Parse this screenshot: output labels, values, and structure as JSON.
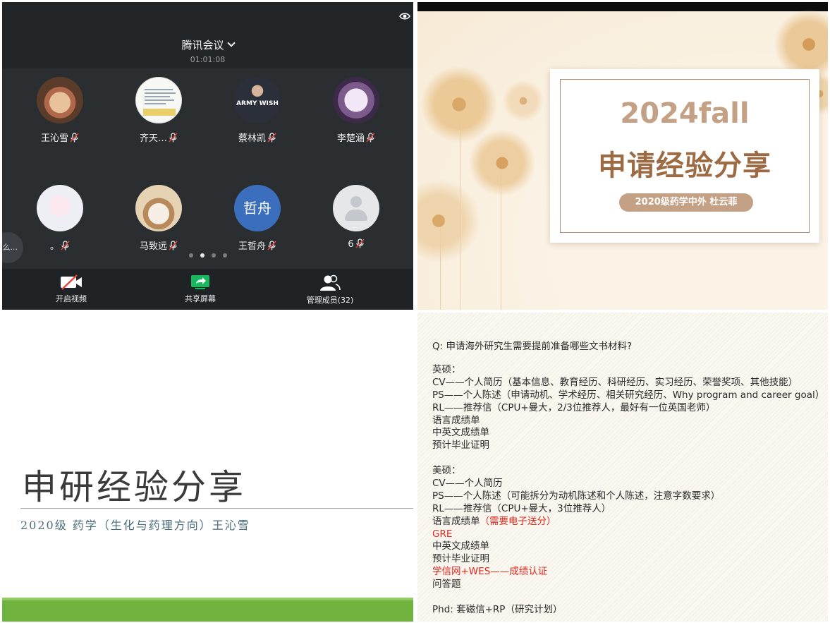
{
  "meeting": {
    "title": "腾讯会议",
    "timer": "01:01:08",
    "members": [
      {
        "name": "王沁雪",
        "avatar": "hamster-photo"
      },
      {
        "name": "齐天…",
        "avatar": "document-thumbnail"
      },
      {
        "name": "蔡林凯",
        "avatar": "army-hoodie-photo",
        "avatar_text": "ARMY WISH"
      },
      {
        "name": "李楚涵",
        "avatar": "anime-avatar"
      },
      {
        "name": "。",
        "avatar": "anime-girl-avatar"
      },
      {
        "name": "马致远",
        "avatar": "cat-avatar"
      },
      {
        "name": "王哲舟",
        "avatar": "text-avatar",
        "avatar_text": "哲舟"
      },
      {
        "name": "6",
        "avatar": "default-avatar"
      }
    ],
    "chat_bubble": "么...",
    "page_dots": {
      "count": 4,
      "active": 2
    },
    "toolbar": {
      "video_label": "开启视频",
      "share_label": "共享屏幕",
      "members_label": "管理成员(32)"
    },
    "colors": {
      "background": "#2b2e31",
      "share_green": "#18b85e",
      "video_off_red": "#e5413b"
    }
  },
  "slide_title": {
    "line1": "2024fall",
    "line2": "申请经验分享",
    "presenter": "2020级药学中外 杜云菲",
    "colors": {
      "accent": "#c4a185",
      "heading": "#9c6b44"
    }
  },
  "slide_intro": {
    "heading": "申研经验分享",
    "subtitle": "2020级 药学（生化与药理方向）王沁雪",
    "colors": {
      "band": "#6fb33e",
      "subtitle": "#4a6d7c"
    }
  },
  "slide_qa": {
    "question": "Q: 申请海外研究生需要提前准备哪些文书材料?",
    "uk_header": "英硕：",
    "uk_items": [
      "CV——个人简历（基本信息、教育经历、科研经历、实习经历、荣誉奖项、其他技能）",
      "PS——个人陈述（申请动机、学术经历、相关研究经历、Why program and career goal）",
      "RL——推荐信（CPU+曼大，2/3位推荐人，最好有一位英国老师）",
      "语言成绩单",
      "中英文成绩单",
      "预计毕业证明"
    ],
    "us_header": "美硕：",
    "us_items": [
      "CV——个人简历",
      "PS——个人陈述（可能拆分为动机陈述和个人陈述，注意字数要求）",
      "RL——推荐信（CPU+曼大，3位推荐人）"
    ],
    "us_language": "语言成绩单",
    "us_language_note": "（需要电子送分）",
    "us_gre": "GRE",
    "us_transcript": "中英文成绩单",
    "us_graduation": "预计毕业证明",
    "us_wes": "学信网+WES——成绩认证",
    "us_qa": "问答题",
    "phd": "Phd: 套磁信+RP（研究计划）",
    "colors": {
      "highlight": "#e0281e"
    }
  }
}
